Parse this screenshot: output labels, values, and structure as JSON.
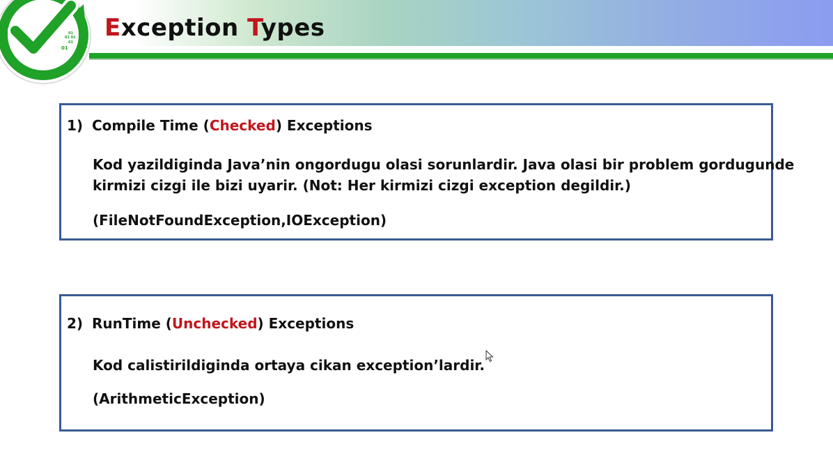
{
  "header": {
    "title_parts": [
      {
        "text": "E",
        "accent": true
      },
      {
        "text": "xception ",
        "accent": false
      },
      {
        "text": "T",
        "accent": true
      },
      {
        "text": "ypes",
        "accent": false
      }
    ]
  },
  "logo": {
    "binary_text": [
      "01",
      "01  01",
      "01",
      "01"
    ]
  },
  "sections": [
    {
      "number": "1)",
      "heading_before": "Compile Time (",
      "heading_highlight": "Checked",
      "heading_after": ") Exceptions",
      "line1": "Kod yazildiginda Java’nin ongordugu olasi sorunlardir. Java olasi bir problem gordugunde",
      "line2": "kirmizi cizgi ile bizi uyarir. (Not: Her kirmizi cizgi exception degildir.)",
      "examples": "(FileNotFoundException,IOException)"
    },
    {
      "number": "2)",
      "heading_before": "RunTime (",
      "heading_highlight": "Unchecked",
      "heading_after": ") Exceptions",
      "line1": "Kod calistirildiginda ortaya cikan exception’lardir.",
      "examples": "(ArithmeticException)"
    }
  ],
  "colors": {
    "accent_red": "#c0161c",
    "brand_green": "#1fa32a",
    "box_border": "#3a5a95"
  },
  "icons": [
    "checkmark-logo-icon",
    "mouse-cursor-icon"
  ]
}
